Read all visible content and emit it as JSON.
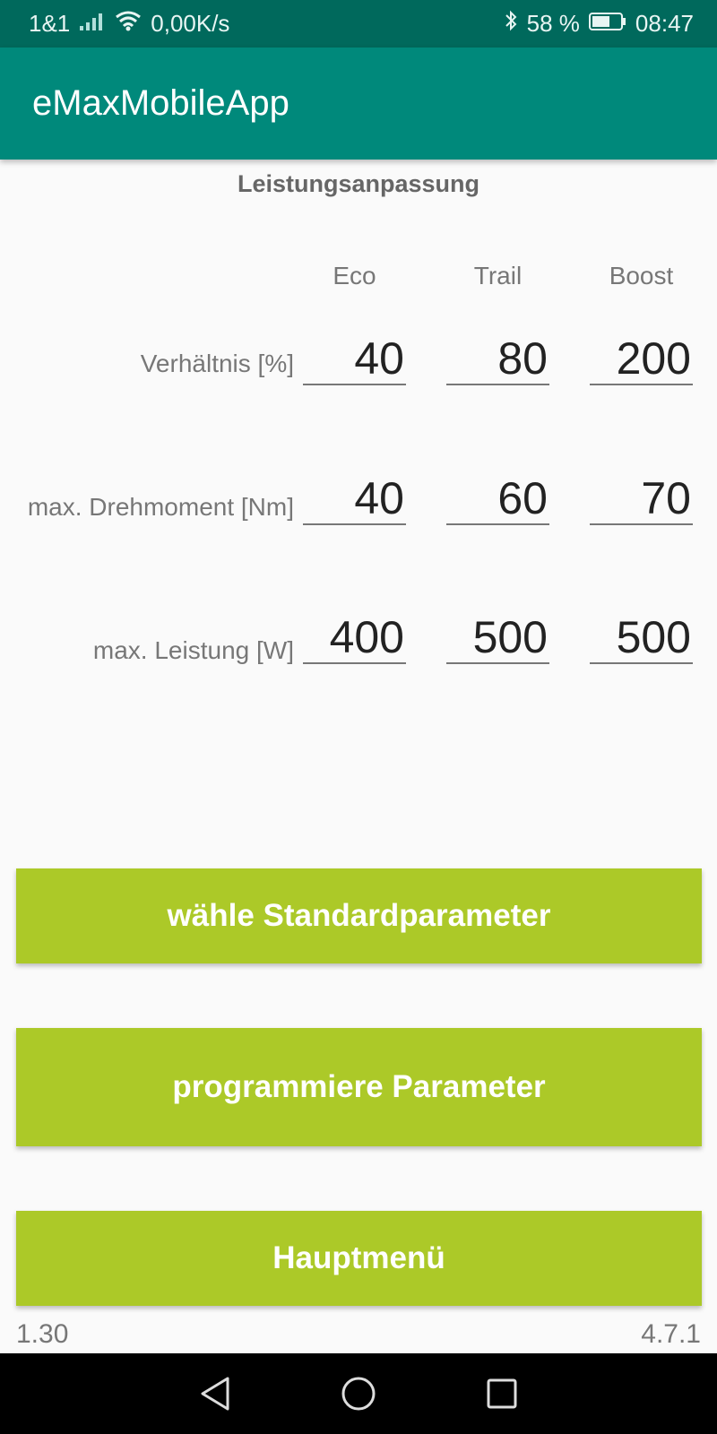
{
  "status_bar": {
    "carrier": "1&1",
    "speed": "0,00K/s",
    "battery": "58 %",
    "time": "08:47"
  },
  "app_bar": {
    "title": "eMaxMobileApp"
  },
  "section": {
    "title": "Leistungsanpassung"
  },
  "table": {
    "columns": [
      "Eco",
      "Trail",
      "Boost"
    ],
    "rows": [
      {
        "label": "Verhältnis [%]",
        "values": [
          "40",
          "80",
          "200"
        ]
      },
      {
        "label": "max. Drehmoment [Nm]",
        "values": [
          "40",
          "60",
          "70"
        ]
      },
      {
        "label": "max. Leistung [W]",
        "values": [
          "400",
          "500",
          "500"
        ]
      }
    ]
  },
  "buttons": {
    "standard": "wähle Standardparameter",
    "program": "programmiere Parameter",
    "main_menu": "Hauptmenü"
  },
  "footer": {
    "left": "1.30",
    "right": "4.7.1"
  },
  "colors": {
    "status_bar": "#00695c",
    "app_bar": "#00897b",
    "button": "#acc928"
  }
}
